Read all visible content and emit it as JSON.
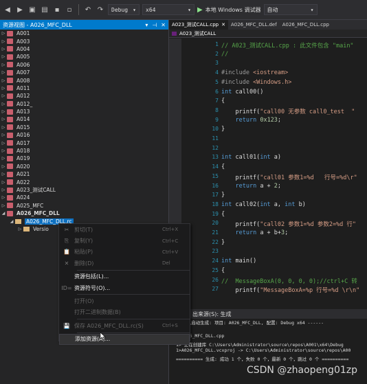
{
  "toolbar": {
    "config": "Debug",
    "platform": "x64",
    "run_label": "本地 Windows 调试器",
    "mode": "自动"
  },
  "resource_view": {
    "title": "资源视图 - A026_MFC_DLL",
    "items": [
      "A001",
      "A003",
      "A004",
      "A005",
      "A006",
      "A007",
      "A008",
      "A011",
      "A012",
      "A012_",
      "A013",
      "A014",
      "A015",
      "A016",
      "A017",
      "A018",
      "A019",
      "A020",
      "A021",
      "A022",
      "A023_测试CALL",
      "A024",
      "A025_MFC"
    ],
    "expanded_item": "A026_MFC_DLL",
    "selected_child": "A026_MFC_DLL.rc",
    "grandchild": "Versio"
  },
  "context_menu": {
    "items": [
      {
        "icon": "✂",
        "label": "剪切(T)",
        "shortcut": "Ctrl+X",
        "disabled": true
      },
      {
        "icon": "⎘",
        "label": "复制(Y)",
        "shortcut": "Ctrl+C",
        "disabled": true
      },
      {
        "icon": "📋",
        "label": "粘贴(P)",
        "shortcut": "Ctrl+V",
        "disabled": true
      },
      {
        "icon": "✕",
        "label": "删除(D)",
        "shortcut": "Del",
        "disabled": true
      },
      {
        "icon": "",
        "label": "资源包括(L)...",
        "shortcut": "",
        "disabled": false
      },
      {
        "icon": "ID=",
        "label": "资源符号(O)...",
        "shortcut": "",
        "disabled": false
      },
      {
        "icon": "",
        "label": "打开(O)",
        "shortcut": "",
        "disabled": true
      },
      {
        "icon": "",
        "label": "打开二进制数据(B)",
        "shortcut": "",
        "disabled": true
      },
      {
        "icon": "💾",
        "label": "保存 A026_MFC_DLL.rc(S)",
        "shortcut": "Ctrl+S",
        "disabled": true
      },
      {
        "icon": "",
        "label": "添加资源(A)...",
        "shortcut": "",
        "disabled": false
      }
    ]
  },
  "editor": {
    "tabs": [
      "A023_测试CALL.cpp",
      "A026_MFC_DLL.def",
      "A026_MFC_DLL.cpp"
    ],
    "scope": "A023_测试CALL",
    "line_numbers": [
      "1",
      "2",
      "3",
      "4",
      "5",
      "6",
      "7",
      "8",
      "9",
      "10",
      "11",
      "12",
      "13",
      "14",
      "15",
      "16",
      "17",
      "18",
      "19",
      "20",
      "21",
      "22",
      "23",
      "24",
      "25",
      "26",
      "27"
    ],
    "lines": [
      "// A023_测试CALL.cpp : 此文件包含 \"main\"",
      "//",
      "",
      "#include <iostream>",
      "#include <Windows.h>",
      "int call00()",
      "{",
      "    printf(\"call00 无参数 call0_test  \"",
      "    return 0x123;",
      "}",
      "",
      "",
      "int call01(int a)",
      "{",
      "    printf(\"call01 参数1=%d   行号=%d\\r\"",
      "    return a + 2;",
      "}",
      "int call02(int a, int b)",
      "{",
      "    printf(\"call02 参数1=%d 参数2=%d 行\"",
      "    return a + b+3;",
      "}",
      "",
      "int main()",
      "{",
      "//  MessageBoxA(0, 0, 0, 0);//ctrl+C 转",
      "    printf(\"MessageBoxA=%p 行号=%d \\r\\n\""
    ]
  },
  "output": {
    "title": "出来源(S): 生成",
    "lines": [
      "--- 已启动生成: 项目: A026_MFC_DLL, 配置: Debug x64 ------",
      "cpp",
      "1>A026_MFC_DLL.cpp",
      "1>  正在创建库 C:\\Users\\Administrator\\source\\repos\\A001\\x64\\Debug",
      "1>A026_MFC_DLL.vcxproj -> C:\\Users\\Administrator\\source\\repos\\A00",
      "========== 生成: 成功 1 个，失败 0 个，最新 0 个，跳过 0 个 =========="
    ]
  },
  "watermark": "CSDN @zhaopeng01zp"
}
